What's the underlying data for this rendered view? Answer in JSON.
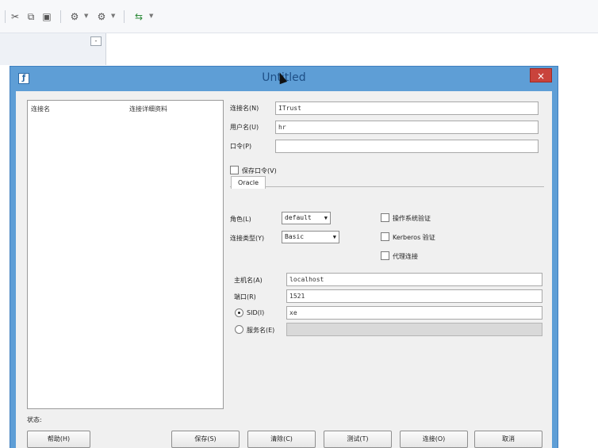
{
  "toolbar": {
    "icons": [
      "cut-icon",
      "copy-icon",
      "paste-icon",
      "gear-icon",
      "gear-icon",
      "connect-icon"
    ]
  },
  "panel": {
    "minimize_label": "-"
  },
  "dialog": {
    "title": "Untitled",
    "close_label": "×",
    "list": {
      "columns": [
        "连接名",
        "连接详细资料"
      ]
    },
    "form": {
      "conn_name_label": "连接名(N)",
      "conn_name_value": "ITrust",
      "username_label": "用户名(U)",
      "username_value": "hr",
      "password_label": "口令(P)",
      "password_value": "",
      "save_password_label": "保存口令(V)"
    },
    "tab": {
      "label": "Oracle"
    },
    "oracle": {
      "role_label": "角色(L)",
      "role_value": "default",
      "conn_type_label": "连接类型(Y)",
      "conn_type_value": "Basic",
      "os_auth_label": "操作系统验证",
      "kerberos_label": "Kerberos 验证",
      "proxy_label": "代理连接",
      "host_label": "主机名(A)",
      "host_value": "localhost",
      "port_label": "端口(R)",
      "port_value": "1521",
      "sid_label": "SID(I)",
      "sid_value": "xe",
      "service_label": "服务名(E)",
      "service_value": ""
    },
    "status_label": "状态:",
    "buttons": {
      "help": "帮助(H)",
      "save": "保存(S)",
      "clear": "清除(C)",
      "test": "测试(T)",
      "connect": "连接(O)",
      "cancel": "取消"
    }
  }
}
